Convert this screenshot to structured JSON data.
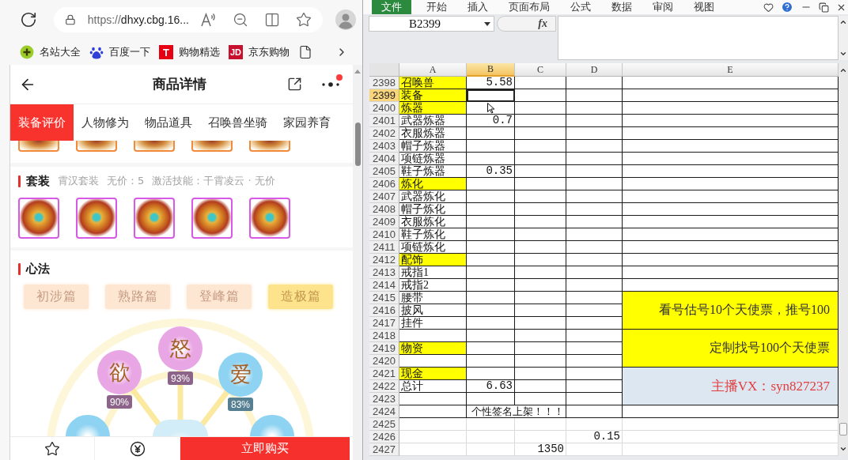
{
  "browser": {
    "url_scheme": "https://",
    "url_host": "dhxy.cbg.16...",
    "bookmarks": [
      {
        "label": "名站大全",
        "kind": "plus"
      },
      {
        "label": "百度一下",
        "kind": "paw"
      },
      {
        "label": "购物精选",
        "kind": "letter",
        "logo": "T"
      },
      {
        "label": "京东购物",
        "kind": "letter",
        "logo": "JD"
      }
    ]
  },
  "header": {
    "title": "商品详情",
    "more_badge": true
  },
  "tabs": [
    {
      "label": "装备评价",
      "selected": true
    },
    {
      "label": "人物修为",
      "selected": false
    },
    {
      "label": "物品道具",
      "selected": false
    },
    {
      "label": "召唤兽坐骑",
      "selected": false
    },
    {
      "label": "家园养育",
      "selected": false
    }
  ],
  "suit": {
    "title": "套装",
    "name": "霄汉套装",
    "value": "无价：5",
    "skill": "激活技能：干霄凌云 · 无价"
  },
  "xinfa": {
    "title": "心法",
    "levels": [
      {
        "label": "初涉篇",
        "selected": false
      },
      {
        "label": "熟路篇",
        "selected": false
      },
      {
        "label": "登峰篇",
        "selected": false
      },
      {
        "label": "造极篇",
        "selected": true
      }
    ]
  },
  "emotions": [
    {
      "label": "怒",
      "reading": "93%",
      "color": "#e9a6e5"
    },
    {
      "label": "欲",
      "reading": "90%",
      "color": "#e9a6e5"
    },
    {
      "label": "爱",
      "reading": "83%",
      "color": "#8fd3f2"
    },
    {
      "color": "#8fd3f2"
    },
    {
      "color": "#d2edf8"
    },
    {
      "color": "#8fd3f2"
    }
  ],
  "bottom_bar": {
    "buy": "立即购买"
  },
  "excel": {
    "ribbon": [
      {
        "label": "文件",
        "kind": "file"
      },
      {
        "label": "开始",
        "kind": "tab"
      },
      {
        "label": "插入",
        "kind": "tab"
      },
      {
        "label": "页面布局",
        "kind": "tab"
      },
      {
        "label": "公式",
        "kind": "tab"
      },
      {
        "label": "数据",
        "kind": "tab"
      },
      {
        "label": "审阅",
        "kind": "tab"
      },
      {
        "label": "视图",
        "kind": "tab"
      }
    ],
    "name_box": "B2399",
    "function_button": "fx",
    "columns": [
      {
        "label": "A",
        "selected": false
      },
      {
        "label": "B",
        "selected": true
      },
      {
        "label": "C",
        "selected": false
      },
      {
        "label": "D",
        "selected": false
      },
      {
        "label": "E",
        "selected": false
      }
    ],
    "bands": [
      {
        "rows": [
          {
            "number": "2398",
            "selected": false,
            "bordered": true,
            "highlight": true,
            "a": "召唤兽",
            "b": "5.58"
          },
          {
            "number": "2399",
            "selected": true,
            "bordered": true,
            "highlight": true,
            "a": "装备"
          },
          {
            "number": "2400",
            "selected": false,
            "bordered": true,
            "highlight": true,
            "a": "炼器"
          },
          {
            "number": "2401",
            "selected": false,
            "bordered": true,
            "highlight": false,
            "a": "武器炼器",
            "b": "0.7"
          },
          {
            "number": "2402",
            "selected": false,
            "bordered": true,
            "highlight": false,
            "a": "衣服炼器"
          },
          {
            "number": "2403",
            "selected": false,
            "bordered": true,
            "highlight": false,
            "a": "帽子炼器"
          },
          {
            "number": "2404",
            "selected": false,
            "bordered": true,
            "highlight": false,
            "a": "项链炼器"
          },
          {
            "number": "2405",
            "selected": false,
            "bordered": true,
            "highlight": false,
            "a": "鞋子炼器",
            "b": "0.35"
          },
          {
            "number": "2406",
            "selected": false,
            "bordered": true,
            "highlight": true,
            "a": "炼化"
          },
          {
            "number": "2407",
            "selected": false,
            "bordered": true,
            "highlight": false,
            "a": "武器炼化"
          },
          {
            "number": "2408",
            "selected": false,
            "bordered": true,
            "highlight": false,
            "a": "帽子炼化"
          },
          {
            "number": "2409",
            "selected": false,
            "bordered": true,
            "highlight": false,
            "a": "衣服炼化"
          },
          {
            "number": "2410",
            "selected": false,
            "bordered": true,
            "highlight": false,
            "a": "鞋子炼化"
          },
          {
            "number": "2411",
            "selected": false,
            "bordered": true,
            "highlight": false,
            "a": "项链炼化"
          },
          {
            "number": "2412",
            "selected": false,
            "bordered": true,
            "highlight": true,
            "a": "配饰"
          },
          {
            "number": "2413",
            "selected": false,
            "bordered": true,
            "highlight": false,
            "a": "戒指1"
          },
          {
            "number": "2414",
            "selected": false,
            "bordered": true,
            "highlight": false,
            "a": "戒指2"
          }
        ]
      },
      {
        "note": {
          "text": "看号估号10个天使票，推号100",
          "color": "#ffff00",
          "emphasis": false
        },
        "rows": [
          {
            "number": "2415",
            "selected": false,
            "bordered": true,
            "highlight": false,
            "a": "腰带"
          },
          {
            "number": "2416",
            "selected": false,
            "bordered": true,
            "highlight": false,
            "a": "披风"
          },
          {
            "number": "2417",
            "selected": false,
            "bordered": true,
            "highlight": false,
            "a": "挂件"
          }
        ]
      },
      {
        "note": {
          "text": "定制找号100个天使票",
          "color": "#ffff00",
          "emphasis": false
        },
        "rows": [
          {
            "number": "2418",
            "selected": false,
            "bordered": true,
            "highlight": false
          },
          {
            "number": "2419",
            "selected": false,
            "bordered": true,
            "highlight": true,
            "a": "物资"
          },
          {
            "number": "2420",
            "selected": false,
            "bordered": true,
            "highlight": false
          }
        ]
      },
      {
        "note": {
          "text": "主播VX：syn827237",
          "color": "#dde7f2",
          "emphasis": true
        },
        "rows": [
          {
            "number": "2421",
            "selected": false,
            "bordered": true,
            "highlight": true,
            "a": "现金"
          },
          {
            "number": "2422",
            "selected": false,
            "bordered": true,
            "highlight": false,
            "a": "总计",
            "b": "6.63"
          },
          {
            "number": "2423",
            "selected": false,
            "bordered": true,
            "highlight": false
          }
        ]
      },
      {
        "rows": [
          {
            "number": "2424",
            "selected": false,
            "bordered": true,
            "highlight": false,
            "bc": "个性签名上架！！！"
          },
          {
            "number": "2425",
            "selected": false,
            "bordered": false,
            "highlight": false
          },
          {
            "number": "2426",
            "selected": false,
            "bordered": false,
            "highlight": false,
            "d": "0.15"
          },
          {
            "number": "2427",
            "selected": false,
            "bordered": false,
            "highlight": false,
            "c": "1350"
          }
        ]
      }
    ]
  }
}
